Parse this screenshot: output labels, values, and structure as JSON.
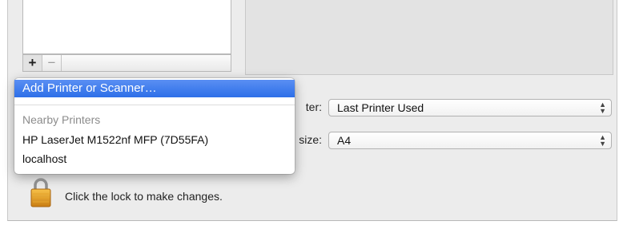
{
  "list_toolbar": {
    "add_label": "+",
    "remove_label": "−"
  },
  "settings": {
    "default_printer_label": "ter:",
    "default_printer_value": "Last Printer Used",
    "paper_size_label": "size:",
    "paper_size_value": "A4"
  },
  "add_menu": {
    "add_item": "Add Printer or Scanner…",
    "section_header": "Nearby Printers",
    "printers": [
      "HP LaserJet M1522nf MFP (7D55FA)",
      "localhost"
    ]
  },
  "footer": {
    "lock_text": "Click the lock to make changes."
  },
  "colors": {
    "highlight": "#2d6fe8",
    "window_bg": "#ececec"
  },
  "icons": {
    "lock": "lock-icon"
  }
}
